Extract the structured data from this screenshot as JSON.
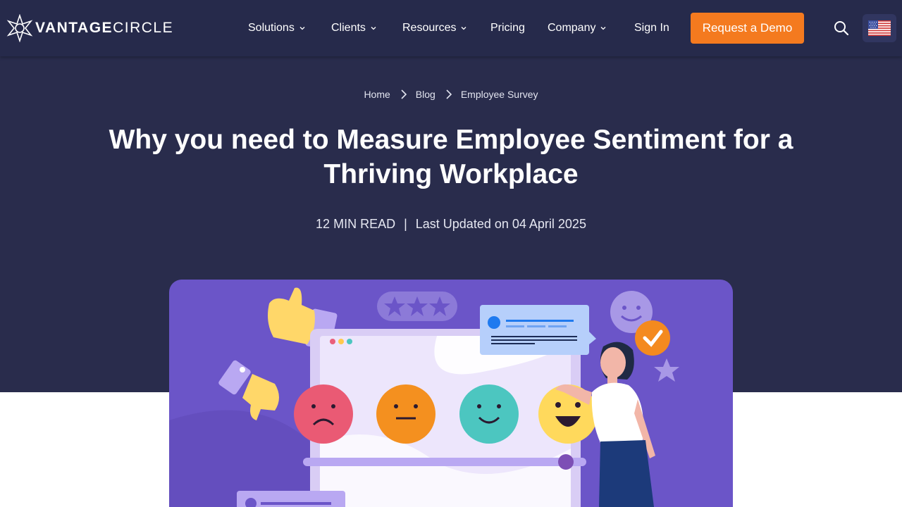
{
  "brand": {
    "name_bold": "VANTAGE",
    "name_light": "CIRCLE"
  },
  "nav": {
    "items": [
      {
        "label": "Solutions",
        "dropdown": true
      },
      {
        "label": "Clients",
        "dropdown": true
      },
      {
        "label": "Resources",
        "dropdown": true
      },
      {
        "label": "Pricing",
        "dropdown": false
      },
      {
        "label": "Company",
        "dropdown": true
      }
    ],
    "sign_in": "Sign In",
    "demo_button": "Request a Demo",
    "search_icon": "search-icon",
    "region_flag": "us-flag-icon"
  },
  "breadcrumb": [
    "Home",
    "Blog",
    "Employee Survey"
  ],
  "article": {
    "title": "Why you need to Measure Employee Sentiment for a Thriving Workplace",
    "read_time": "12 MIN READ",
    "separator": "|",
    "updated": "Last Updated on 04 April 2025"
  },
  "colors": {
    "nav_bg": "#262a4b",
    "hero_bg": "#292c4c",
    "accent_orange": "#f47a1f",
    "illustration_bg": "#6b55c8"
  }
}
